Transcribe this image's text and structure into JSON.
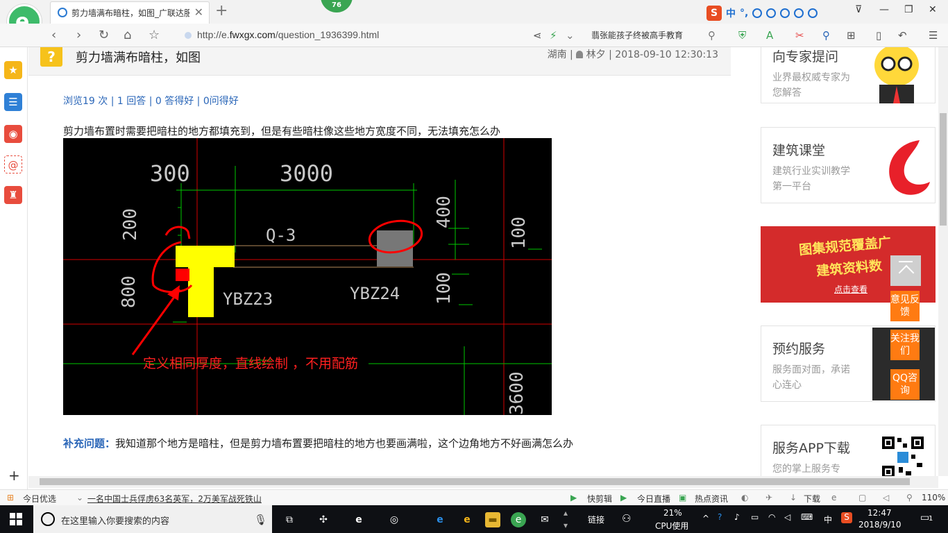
{
  "browser": {
    "tab_title": "剪力墙满布暗柱，如图_广联达服务新干线",
    "notification_count": "76",
    "url_prefix": "http://e.",
    "url_domain": "fwxgx.com",
    "url_path": "/question_1936399.html",
    "nav_suggestion": "翡张能孩子终被高手教育",
    "sogou_labels": [
      "中",
      "°,"
    ]
  },
  "question": {
    "title": "剪力墙满布暗柱，如图",
    "region": "湖南",
    "author": "林夕",
    "datetime": "2018-09-10 12:30:13",
    "stats": "浏览19 次 | 1 回答 | 0 答得好 | 0问得好",
    "description": "剪力墙布置时需要把暗柱的地方都填充到，但是有些暗柱像这些地方宽度不同，无法填充怎么办",
    "supplement_label": "补充问题：",
    "supplement_text": "我知道那个地方是暗柱，但是剪力墙布置要把暗柱的地方也要画满啦，这个边角地方不好画满怎么办"
  },
  "cad": {
    "dims": [
      "300",
      "3000",
      "200",
      "400",
      "100",
      "800",
      "100",
      "3600"
    ],
    "wall_label": "Q-3",
    "column1": "YBZ23",
    "column2": "YBZ24",
    "annotation": "定义相同厚度，直线绘制 ，不用配筋",
    "colors": {
      "background": "#000000",
      "column_fill": "#ffff00",
      "highlight": "#ff0000",
      "dimension": "#00c800",
      "axis": "#ff0000",
      "text": "#c8c8c8"
    }
  },
  "sidebar": {
    "expert": {
      "title": "向专家提问",
      "sub": "业界最权威专家为您解答"
    },
    "classroom": {
      "title": "建筑课堂",
      "sub": "建筑行业实训教学第一平台"
    },
    "banner": {
      "line1": "图集规范覆盖广",
      "line2": "建筑资料数",
      "link": "点击查看"
    },
    "booking": {
      "title": "预约服务",
      "sub": "服务面对面，承诺心连心"
    },
    "app": {
      "title": "服务APP下载",
      "sub": "您的掌上服务专"
    }
  },
  "float_buttons": [
    "意见反馈",
    "关注我们",
    "QQ咨询"
  ],
  "statusbar": {
    "today": "今日优选",
    "news": "一名中国士兵俘虏63名英军，2万美军战死铁山",
    "items": [
      "快剪辑",
      "今日直播",
      "热点资讯",
      "下载"
    ],
    "zoom": "110%"
  },
  "taskbar": {
    "search_placeholder": "在这里输入你要搜索的内容",
    "links_label": "链接",
    "cpu_percent": "21%",
    "cpu_label": "CPU使用",
    "ime": "中",
    "time": "12:47",
    "date": "2018/9/10",
    "notifications": "1"
  }
}
